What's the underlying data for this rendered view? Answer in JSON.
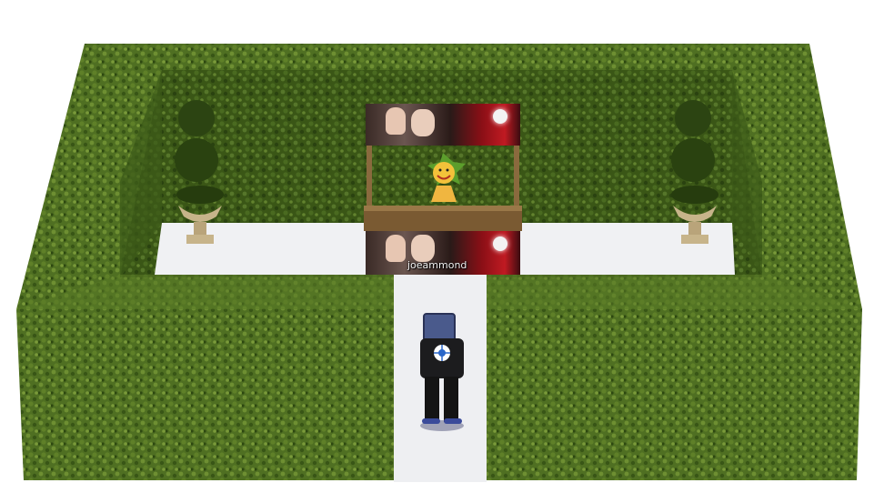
{
  "scene": {
    "colors": {
      "hedge": "#4a6a1e",
      "hedge_dark": "#2f4a12",
      "path": "#f1f1f3",
      "wood": "#7a5a32",
      "background": "#ffffff"
    }
  },
  "stall": {
    "owner_name": "joeammond"
  },
  "avatar": {
    "shirt_emblem": "snowflake-icon"
  }
}
